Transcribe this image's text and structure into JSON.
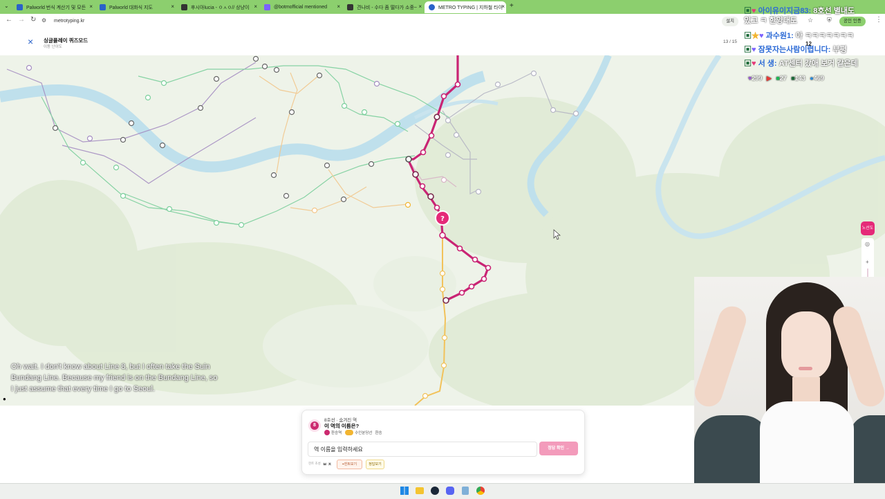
{
  "browser": {
    "tabs": [
      {
        "label": "Palworld 번식 계산기 및 모든",
        "fav_color": "#2a62c9"
      },
      {
        "label": "Palworld 대화식 지도",
        "fav_color": "#2a62c9"
      },
      {
        "label": "후시아lucia - ㅇㅅㅇ// 상냥이",
        "fav_color": "#333333"
      },
      {
        "label": "@botmofficial mentioned",
        "fav_color": "#7b61ff"
      },
      {
        "label": "견나비 - 수다 좀 떨다가 소중~",
        "fav_color": "#333333"
      },
      {
        "label": "METRO TYPING | 지하철 타이",
        "fav_color": "#2a62c9"
      }
    ],
    "new_tab_symbol": "+",
    "url": "metrotyping.kr",
    "install_label": "설치",
    "profile_label": "공인 인증"
  },
  "app": {
    "close_symbol": "×",
    "title": "싱글플레이 퀴즈모드",
    "subtitle": "이동 난이도",
    "progress_text": "13 / 15",
    "zoom_label": "12"
  },
  "map": {
    "question_marker": "?",
    "right_control_label": "노선도"
  },
  "quiz": {
    "line_badge": "8",
    "line_info": "8호선 · 숨겨진 역",
    "question": "이 역의 이름은?",
    "transfer_label": "환승역",
    "transfer_line": "수인분당선",
    "transfer_suffix": "환승",
    "input_placeholder": "역 이름을 입력하세요",
    "submit_label": "정답 확인 →",
    "hint_caption": "힌트 초성",
    "hint_value": "ㅂ ㅈ",
    "hint_button": "힌트보기",
    "answer_button": "정답보기"
  },
  "chat": [
    {
      "user": "아이유이지금83:",
      "text": "8호선 별내도",
      "color": "#2d6bd6"
    },
    {
      "user": "",
      "text": "있고 ㅋ 한양대도",
      "color": "#2d6bd6"
    },
    {
      "user": "과수원1:",
      "text": "아 ㅋㅋㅋㅋㅋㅋㅋ",
      "color": "#2d6bd6"
    },
    {
      "user": "잠못자는사람이렵니다:",
      "text": "부평",
      "color": "#2d6bd6"
    },
    {
      "user": "서 생:",
      "text": "AT센터 갔애 보거 같은데",
      "color": "#2d6bd6"
    }
  ],
  "viewer_stats": [
    {
      "icon": "heart-icon",
      "value": "299",
      "color": "#9b59d6"
    },
    {
      "icon": "youtube-icon",
      "value": "",
      "color": "#e53935"
    },
    {
      "icon": "chzzk-icon",
      "value": "27",
      "color": "#1db954"
    },
    {
      "icon": "soop-icon",
      "value": "143",
      "color": "#1d6b3a"
    },
    {
      "icon": "user-icon",
      "value": "469",
      "color": "#2a8ad9"
    }
  ],
  "subtitles": "Oh wait. I don't know about Line 8, but I often take the Suin Bundang Line. Because my friend is on the Bundang Line, so I just assume that every time I go to Seoul.",
  "colors": {
    "line8": "#cc2a6f",
    "suin_bundang": "#f2b531",
    "accent_green": "#8ccf6e",
    "submit_pink": "#f39bbb"
  }
}
